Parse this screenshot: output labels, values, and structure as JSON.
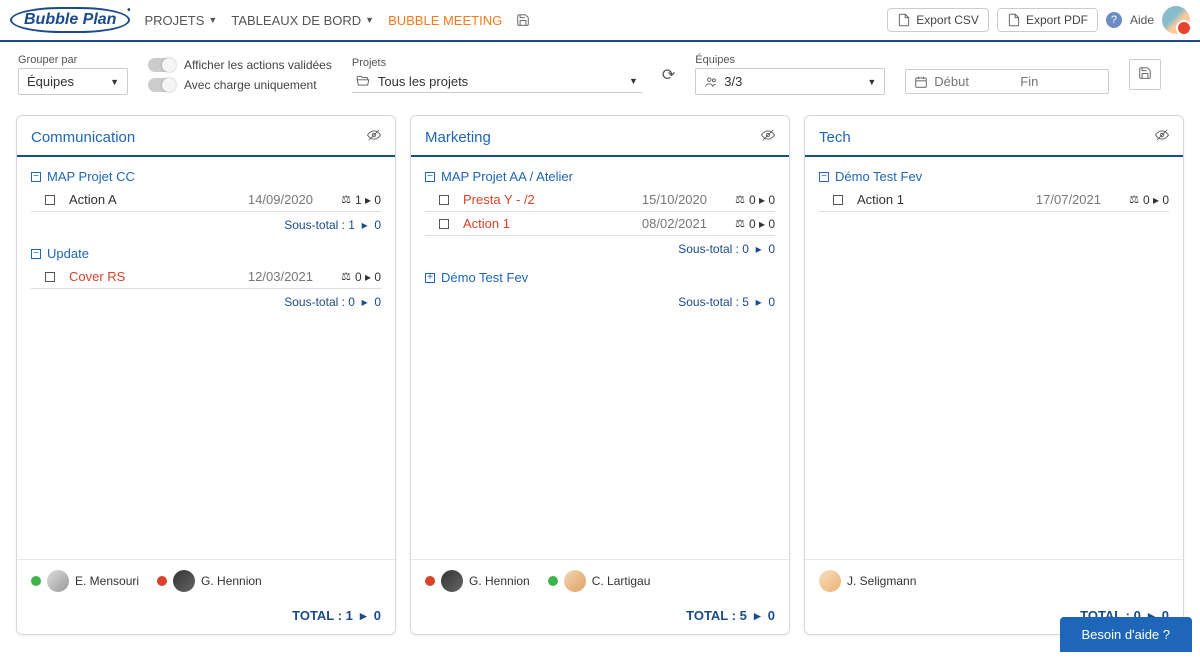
{
  "logo": "Bubble Plan",
  "nav": {
    "projets": "PROJETS",
    "tableaux": "TABLEAUX DE BORD",
    "meeting": "BUBBLE MEETING"
  },
  "top_right": {
    "export_csv": "Export CSV",
    "export_pdf": "Export PDF",
    "aide": "Aide"
  },
  "filters": {
    "group_label": "Grouper par",
    "group_value": "Équipes",
    "toggle_valid": "Afficher les actions validées",
    "toggle_charge": "Avec charge uniquement",
    "projets_label": "Projets",
    "projets_value": "Tous les projets",
    "equipes_label": "Équipes",
    "equipes_value": "3/3",
    "debut_ph": "Début",
    "fin_ph": "Fin"
  },
  "columns": [
    {
      "title": "Communication",
      "projects": [
        {
          "mode": "minus",
          "name": "MAP Projet CC",
          "actions": [
            {
              "name": "Action A",
              "red": false,
              "date": "14/09/2020",
              "s1": "1",
              "s2": "0"
            }
          ],
          "subtotal": "1",
          "subtotal2": "0"
        },
        {
          "mode": "minus",
          "name": "Update",
          "actions": [
            {
              "name": "Cover RS",
              "red": true,
              "date": "12/03/2021",
              "s1": "0",
              "s2": "0"
            }
          ],
          "subtotal": "0",
          "subtotal2": "0"
        }
      ],
      "people": [
        {
          "dot": "green",
          "av": "v1",
          "name": "E. Mensouri"
        },
        {
          "dot": "red",
          "av": "v2",
          "name": "G. Hennion"
        }
      ],
      "total1": "1",
      "total2": "0"
    },
    {
      "title": "Marketing",
      "projects": [
        {
          "mode": "minus",
          "name": "MAP Projet AA / Atelier",
          "actions": [
            {
              "name": "Presta Y - /2",
              "red": true,
              "date": "15/10/2020",
              "s1": "0",
              "s2": "0"
            },
            {
              "name": "Action 1",
              "red": true,
              "date": "08/02/2021",
              "s1": "0",
              "s2": "0"
            }
          ],
          "subtotal": "0",
          "subtotal2": "0"
        },
        {
          "mode": "plus",
          "name": "Démo Test Fev",
          "actions": [],
          "subtotal": "5",
          "subtotal2": "0"
        }
      ],
      "people": [
        {
          "dot": "red",
          "av": "v2",
          "name": "G. Hennion"
        },
        {
          "dot": "green",
          "av": "v3",
          "name": "C. Lartigau"
        }
      ],
      "total1": "5",
      "total2": "0"
    },
    {
      "title": "Tech",
      "projects": [
        {
          "mode": "minus",
          "name": "Démo Test Fev",
          "actions": [
            {
              "name": "Action 1",
              "red": false,
              "date": "17/07/2021",
              "s1": "0",
              "s2": "0"
            }
          ]
        }
      ],
      "people": [
        {
          "dot": "",
          "av": "v4",
          "name": "J. Seligmann"
        }
      ],
      "total1": "0",
      "total2": "0"
    }
  ],
  "labels": {
    "sous_total": "Sous-total :",
    "total": "TOTAL :"
  },
  "help_widget": "Besoin d'aide ?"
}
